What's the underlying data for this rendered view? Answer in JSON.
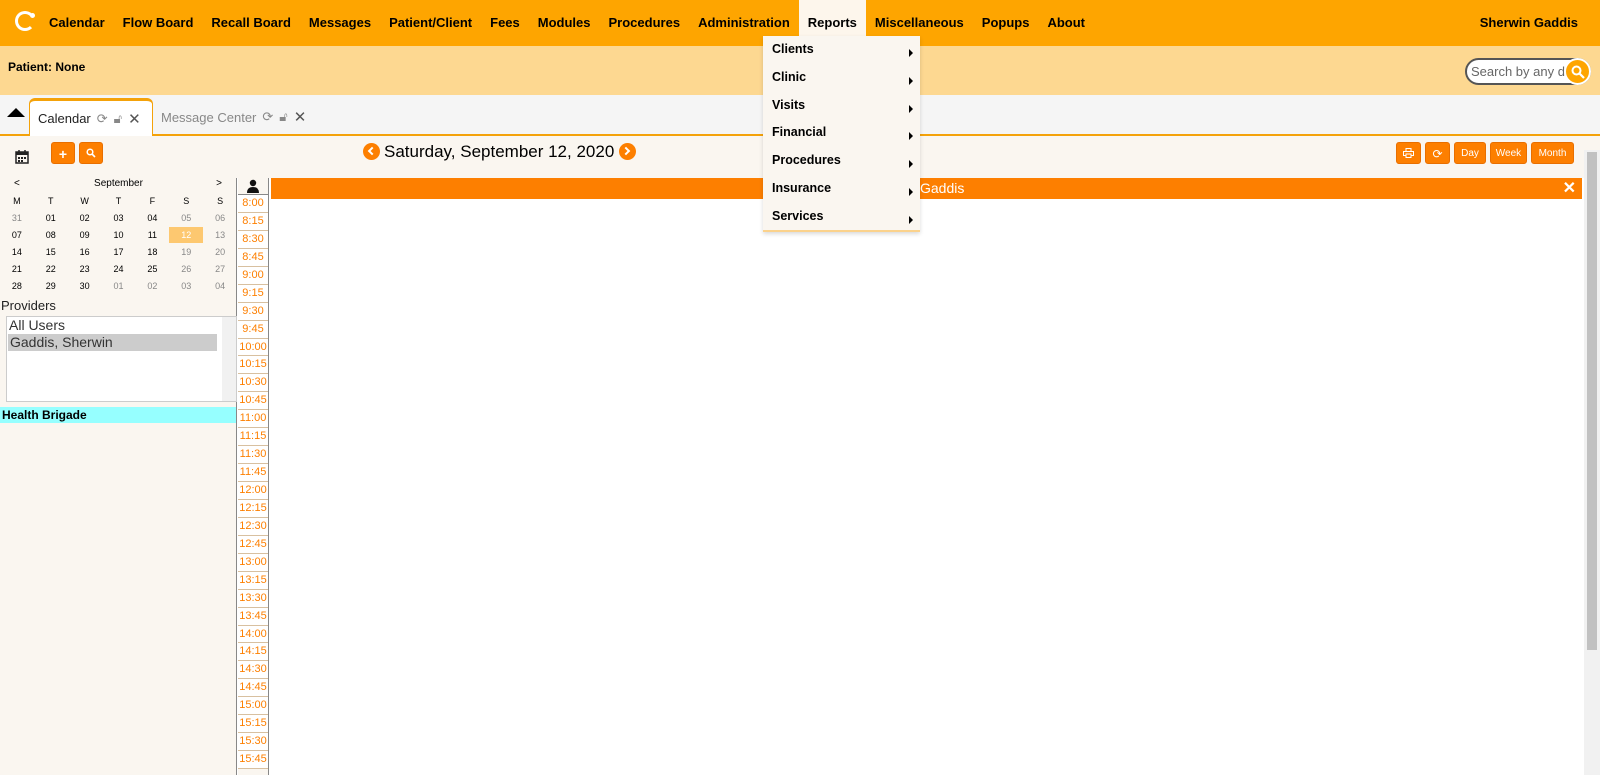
{
  "menu": {
    "items": [
      "Calendar",
      "Flow Board",
      "Recall Board",
      "Messages",
      "Patient/Client",
      "Fees",
      "Modules",
      "Procedures",
      "Administration",
      "Reports",
      "Miscellaneous",
      "Popups",
      "About"
    ],
    "active": "Reports",
    "user": "Sherwin Gaddis"
  },
  "reports_dropdown": [
    "Clients",
    "Clinic",
    "Visits",
    "Financial",
    "Procedures",
    "Insurance",
    "Services"
  ],
  "patient": {
    "label": "Patient: None"
  },
  "search": {
    "placeholder": "Search by any demographics"
  },
  "tabs": [
    {
      "label": "Calendar",
      "active": true
    },
    {
      "label": "Message Center",
      "active": false
    }
  ],
  "toolbar": {
    "date": "Saturday, September 12, 2020",
    "view_buttons": [
      "Day",
      "Week",
      "Month"
    ]
  },
  "mini_calendar": {
    "month": "September",
    "prev": "<",
    "next": ">",
    "weekdays": [
      "M",
      "T",
      "W",
      "T",
      "F",
      "S",
      "S"
    ],
    "weeks": [
      [
        "31",
        "01",
        "02",
        "03",
        "04",
        "05",
        "06"
      ],
      [
        "07",
        "08",
        "09",
        "10",
        "11",
        "12",
        "13"
      ],
      [
        "14",
        "15",
        "16",
        "17",
        "18",
        "19",
        "20"
      ],
      [
        "21",
        "22",
        "23",
        "24",
        "25",
        "26",
        "27"
      ],
      [
        "28",
        "29",
        "30",
        "01",
        "02",
        "03",
        "04"
      ]
    ],
    "selected": "12"
  },
  "providers": {
    "title": "Providers",
    "items": [
      "All Users",
      "Gaddis, Sherwin"
    ],
    "selected": "Gaddis, Sherwin"
  },
  "facility": "Health Brigade",
  "schedule": {
    "provider_header": "Gaddis",
    "times": [
      "8:00",
      "8:15",
      "8:30",
      "8:45",
      "9:00",
      "9:15",
      "9:30",
      "9:45",
      "10:00",
      "10:15",
      "10:30",
      "10:45",
      "11:00",
      "11:15",
      "11:30",
      "11:45",
      "12:00",
      "12:15",
      "12:30",
      "12:45",
      "13:00",
      "13:15",
      "13:30",
      "13:45",
      "14:00",
      "14:15",
      "14:30",
      "14:45",
      "15:00",
      "15:15",
      "15:30",
      "15:45"
    ]
  },
  "colors": {
    "brand": "#fea500",
    "accent": "#fd7f00",
    "patient_bar": "#fdd891",
    "facility": "#96ffff"
  }
}
